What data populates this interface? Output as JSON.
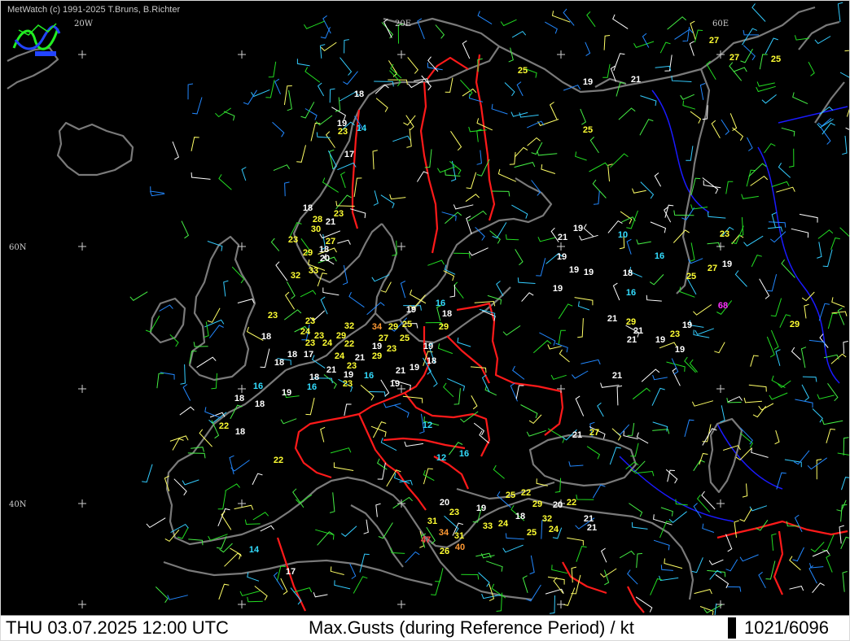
{
  "header": {
    "copyright": "MetWatch  (c) 1991-2025 T.Bruns, B.Richter"
  },
  "status_bar": {
    "datetime": "THU 03.07.2025 12:00 UTC",
    "title": "Max.Gusts (during Reference Period) / kt",
    "station_count": "1021/6096"
  },
  "grid_labels": {
    "lon_20w": "20W",
    "lon_20e": "20E",
    "lon_60e": "60E",
    "lat_60n": "60N",
    "lat_40n": "40N"
  },
  "colors": {
    "background": "#000000",
    "coast": "#7a7a7a",
    "border": "#ff1a1a",
    "river": "#1a1aff",
    "gust_low": "#33ddff",
    "gust_mid": "#ffffff",
    "gust_high": "#ffff33",
    "gust_strong": "#ff9933",
    "gust_severe": "#ff4444",
    "gust_extreme": "#ff33ff"
  },
  "gust_stations": [
    {
      "v": "18"
    },
    {
      "v": "19"
    },
    {
      "v": "23"
    },
    {
      "v": "14"
    },
    {
      "v": "17"
    },
    {
      "v": "25"
    },
    {
      "v": "19"
    },
    {
      "v": "21"
    },
    {
      "v": "25"
    },
    {
      "v": "27"
    },
    {
      "v": "27"
    },
    {
      "v": "25"
    },
    {
      "v": "18"
    },
    {
      "v": "28"
    },
    {
      "v": "21"
    },
    {
      "v": "23"
    },
    {
      "v": "30"
    },
    {
      "v": "23"
    },
    {
      "v": "27"
    },
    {
      "v": "29"
    },
    {
      "v": "18"
    },
    {
      "v": "20"
    },
    {
      "v": "32"
    },
    {
      "v": "33"
    },
    {
      "v": "21"
    },
    {
      "v": "19"
    },
    {
      "v": "10"
    },
    {
      "v": "19"
    },
    {
      "v": "23"
    },
    {
      "v": "19"
    },
    {
      "v": "16"
    },
    {
      "v": "19"
    },
    {
      "v": "19"
    },
    {
      "v": "18"
    },
    {
      "v": "27"
    },
    {
      "v": "25"
    },
    {
      "v": "19"
    },
    {
      "v": "16"
    },
    {
      "v": "16"
    },
    {
      "v": "19"
    },
    {
      "v": "18"
    },
    {
      "v": "68"
    },
    {
      "v": "23"
    },
    {
      "v": "32"
    },
    {
      "v": "34"
    },
    {
      "v": "29"
    },
    {
      "v": "25"
    },
    {
      "v": "29"
    },
    {
      "v": "23"
    },
    {
      "v": "21"
    },
    {
      "v": "29"
    },
    {
      "v": "24"
    },
    {
      "v": "23"
    },
    {
      "v": "27"
    },
    {
      "v": "25"
    },
    {
      "v": "19"
    },
    {
      "v": "18"
    },
    {
      "v": "23"
    },
    {
      "v": "24"
    },
    {
      "v": "29"
    },
    {
      "v": "22"
    },
    {
      "v": "19"
    },
    {
      "v": "23"
    },
    {
      "v": "19"
    },
    {
      "v": "21"
    },
    {
      "v": "23"
    },
    {
      "v": "19"
    },
    {
      "v": "21"
    },
    {
      "v": "29"
    },
    {
      "v": "24"
    },
    {
      "v": "21"
    },
    {
      "v": "23"
    },
    {
      "v": "18"
    },
    {
      "v": "19"
    },
    {
      "v": "16"
    },
    {
      "v": "21"
    },
    {
      "v": "19"
    },
    {
      "v": "18"
    },
    {
      "v": "17"
    },
    {
      "v": "18"
    },
    {
      "v": "21"
    },
    {
      "v": "19"
    },
    {
      "v": "23"
    },
    {
      "v": "18"
    },
    {
      "v": "16"
    },
    {
      "v": "16"
    },
    {
      "v": "19"
    },
    {
      "v": "18"
    },
    {
      "v": "19"
    },
    {
      "v": "18"
    },
    {
      "v": "21"
    },
    {
      "v": "22"
    },
    {
      "v": "18"
    },
    {
      "v": "12"
    },
    {
      "v": "21"
    },
    {
      "v": "27"
    },
    {
      "v": "12"
    },
    {
      "v": "16"
    },
    {
      "v": "22"
    },
    {
      "v": "25"
    },
    {
      "v": "22"
    },
    {
      "v": "29"
    },
    {
      "v": "20"
    },
    {
      "v": "22"
    },
    {
      "v": "20"
    },
    {
      "v": "23"
    },
    {
      "v": "19"
    },
    {
      "v": "18"
    },
    {
      "v": "31"
    },
    {
      "v": "33"
    },
    {
      "v": "24"
    },
    {
      "v": "32"
    },
    {
      "v": "21"
    },
    {
      "v": "47"
    },
    {
      "v": "34"
    },
    {
      "v": "31"
    },
    {
      "v": "25"
    },
    {
      "v": "24"
    },
    {
      "v": "21"
    },
    {
      "v": "26"
    },
    {
      "v": "40"
    },
    {
      "v": "14"
    },
    {
      "v": "17"
    },
    {
      "v": "25"
    },
    {
      "v": "29"
    }
  ]
}
